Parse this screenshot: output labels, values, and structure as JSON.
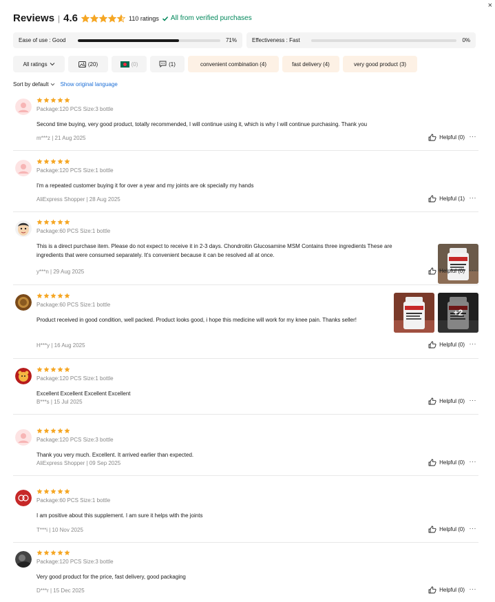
{
  "header": {
    "title": "Reviews",
    "rating": "4.6",
    "stars_value": 4.6,
    "ratings_count": "110 ratings",
    "verified": "All from verified purchases",
    "close": "×"
  },
  "metrics": [
    {
      "label": "Ease of use : Good",
      "percent": "71%",
      "value": 0.71
    },
    {
      "label": "Effectiveness : Fast",
      "percent": "0%",
      "value": 0
    }
  ],
  "filters": {
    "all_ratings": "All ratings",
    "photos": "(20)",
    "country": "(0)",
    "comments": "(1)",
    "tags": [
      "convenient combination (4)",
      "fast delivery (4)",
      "very good product (3)"
    ]
  },
  "sort": {
    "label": "Sort by default",
    "show_original": "Show original language"
  },
  "colors": {
    "star": "#f5a623",
    "verified": "#00875a",
    "link": "#1a6dd6",
    "tag_bg": "#fdf1e5"
  },
  "reviews": [
    {
      "stars": 5,
      "package": "Package:120 PCS Size:3 bottle",
      "text": "Second time buying, very good product, totally recommended, I will continue using it, which is why I will continue purchasing. Thank you",
      "meta": "m***z | 21 Aug 2025",
      "helpful": "Helpful (0)",
      "avatar": "default-avatar"
    },
    {
      "stars": 5,
      "package": "Package:120 PCS Size:1 bottle",
      "text": "I'm a repeated customer buying it for over a year and my joints are ok specially my hands",
      "meta": "AliExpress Shopper | 28 Aug 2025",
      "helpful": "Helpful (1)",
      "avatar": "default-avatar"
    },
    {
      "stars": 5,
      "package": "Package:60 PCS Size:1 bottle",
      "text": "This is a direct purchase item. Please do not expect to receive it in 2-3 days. Chondroitin Glucosamine MSM Contains three ingredients These are ingredients that were consumed separately. It's convenient because it can be resolved all at once.",
      "meta": "y***n | 29 Aug 2025",
      "helpful": "Helpful (0)",
      "avatar": "cartoon-face-avatar"
    },
    {
      "stars": 5,
      "package": "Package:60 PCS Size:1 bottle",
      "text": "Product received in good condition, well packed. Product looks good, i hope this medicine will work for my knee pain. Thanks seller!",
      "meta": "H***y | 16 Aug 2025",
      "helpful": "Helpful (0)",
      "avatar": "emblem-avatar",
      "more_photos": "+2"
    },
    {
      "stars": 5,
      "package": "Package:120 PCS Size:1 bottle",
      "text": "Excellent Excellent Excellent Excellent",
      "meta": "B***s | 15 Jul 2025",
      "helpful": "Helpful (0)",
      "avatar": "bear-avatar"
    },
    {
      "stars": 5,
      "package": "Package:120 PCS Size:3 bottle",
      "text": "Thank you very much. Excellent. It arrived earlier than expected.",
      "meta": "AliExpress Shopper | 09 Sep 2025",
      "helpful": "Helpful (0)",
      "avatar": "default-avatar"
    },
    {
      "stars": 5,
      "package": "Package:60 PCS Size:1 bottle",
      "text": "I am positive about this supplement. I am sure it helps with the joints",
      "meta": "T***i | 10 Nov 2025",
      "helpful": "Helpful (0)",
      "avatar": "red-rings-avatar"
    },
    {
      "stars": 5,
      "package": "Package:120 PCS Size:3 bottle",
      "text": "Very good product for the price, fast delivery, good packaging",
      "meta": "D***r | 15 Dec 2025",
      "helpful": "Helpful (0)",
      "avatar": "photo-avatar"
    }
  ]
}
